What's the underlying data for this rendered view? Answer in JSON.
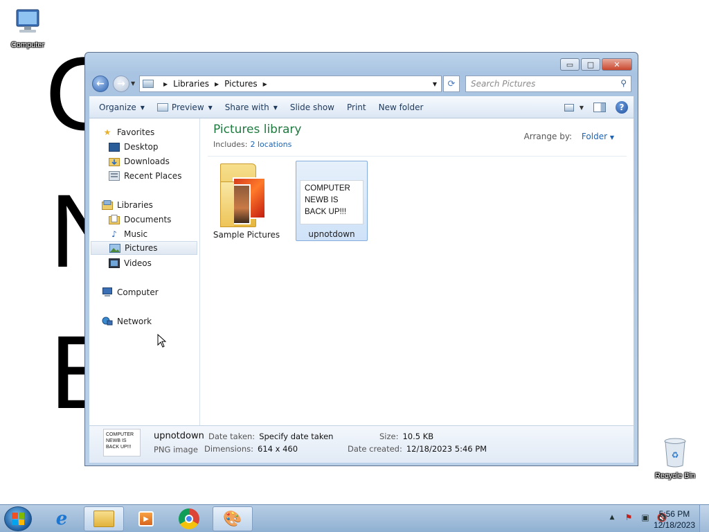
{
  "wallpaper": {
    "letters": [
      "C",
      "N",
      "B"
    ]
  },
  "desktop_icons": {
    "computer": "Computer",
    "recycle_bin": "Recycle Bin"
  },
  "window": {
    "controls": {
      "minimize": "▭",
      "maximize": "□",
      "close": "✕"
    },
    "address": {
      "crumbs": [
        "Libraries",
        "Pictures"
      ]
    },
    "search": {
      "placeholder": "Search Pictures"
    },
    "toolbar": {
      "organize": "Organize",
      "preview": "Preview",
      "share_with": "Share with",
      "slide_show": "Slide show",
      "print": "Print",
      "new_folder": "New folder"
    },
    "nav": {
      "favorites": "Favorites",
      "desktop": "Desktop",
      "downloads": "Downloads",
      "recent_places": "Recent Places",
      "libraries": "Libraries",
      "documents": "Documents",
      "music": "Music",
      "pictures": "Pictures",
      "videos": "Videos",
      "computer": "Computer",
      "network": "Network"
    },
    "content": {
      "title": "Pictures library",
      "includes_label": "Includes:",
      "includes_link": "2 locations",
      "arrange_label": "Arrange by:",
      "arrange_value": "Folder",
      "items": [
        {
          "name": "Sample Pictures",
          "type": "folder"
        },
        {
          "name": "upnotdown",
          "type": "image",
          "thumb_lines": [
            "COMPUTER",
            "NEWB IS",
            "BACK UP!!!"
          ]
        }
      ]
    },
    "details": {
      "thumb_lines": [
        "COMPUTER",
        "NEWB IS",
        "BACK UP!!!"
      ],
      "name": "upnotdown",
      "type": "PNG image",
      "date_taken_label": "Date taken:",
      "date_taken_value": "Specify date taken",
      "dimensions_label": "Dimensions:",
      "dimensions_value": "614 x 460",
      "size_label": "Size:",
      "size_value": "10.5 KB",
      "date_created_label": "Date created:",
      "date_created_value": "12/18/2023 5:46 PM"
    }
  },
  "taskbar": {
    "clock_time": "5:56 PM",
    "clock_date": "12/18/2023",
    "tray_up_arrow": "▲"
  }
}
